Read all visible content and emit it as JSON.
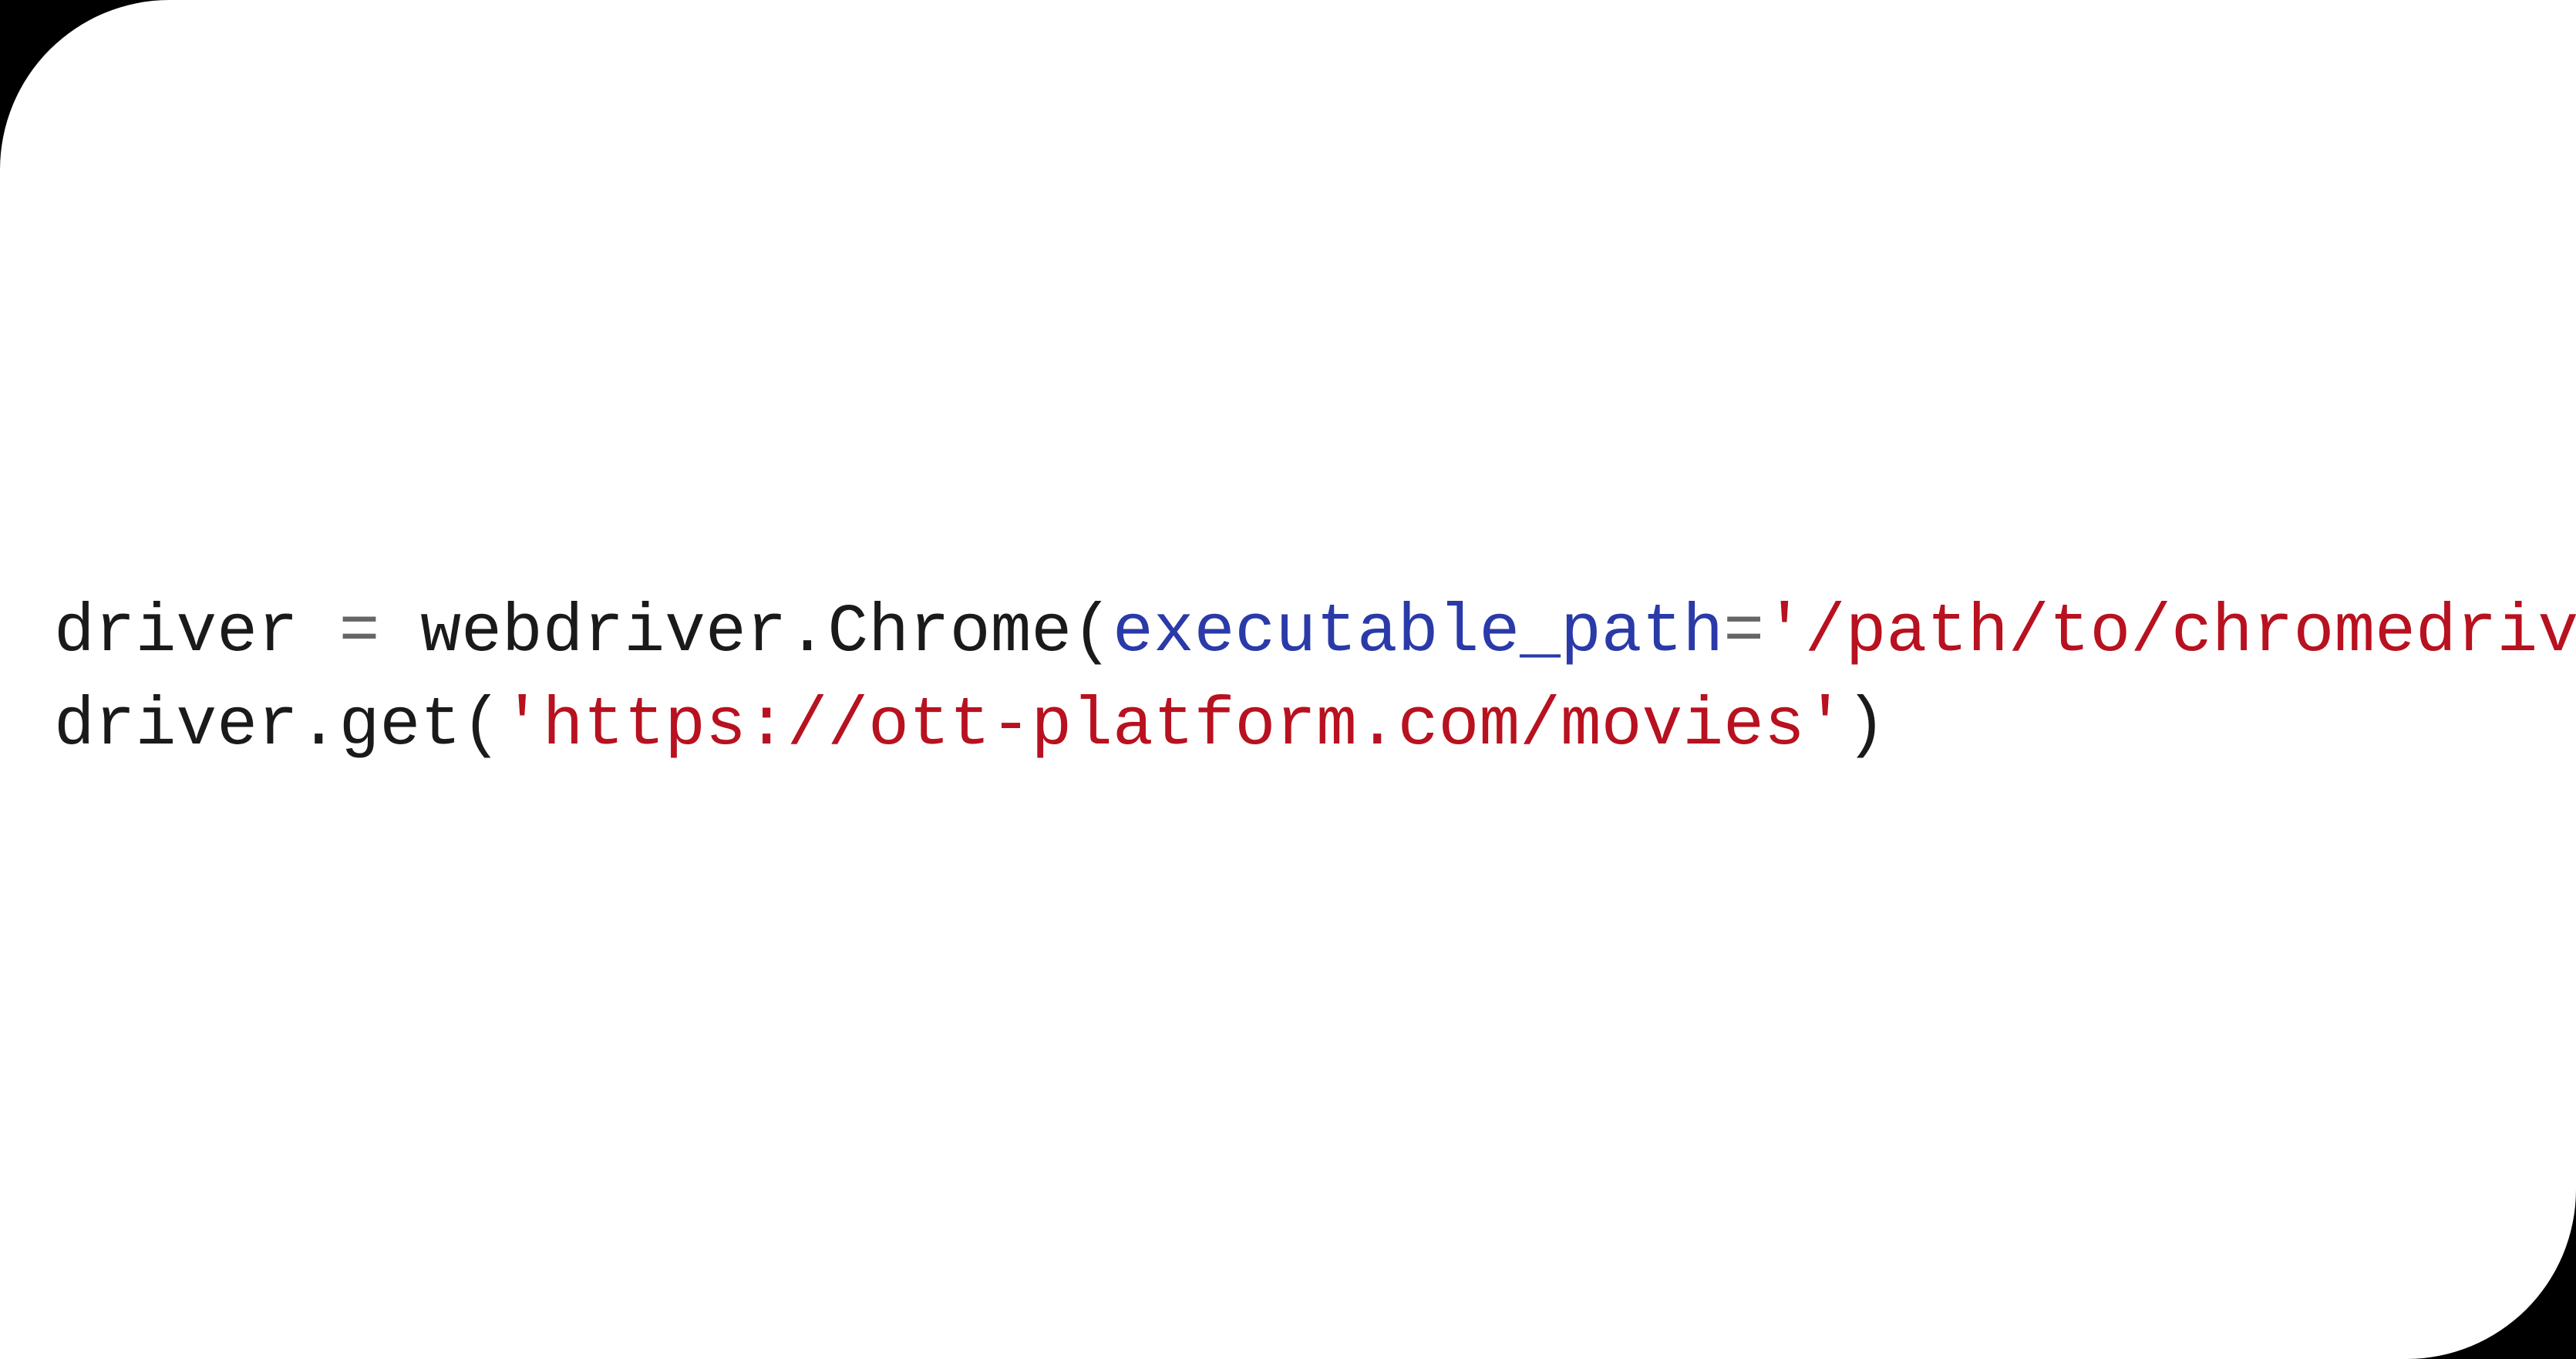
{
  "code": {
    "line1": {
      "t0": "driver ",
      "t1": "=",
      "t2": " webdriver.Chrome(",
      "t3": "executable_path",
      "t4": "=",
      "t5": "'/path/to/chromedriver'",
      "t6": ")"
    },
    "line2": {
      "t0": "driver.get(",
      "t1": "'https://ott-platform.com/movies'",
      "t2": ")"
    }
  }
}
